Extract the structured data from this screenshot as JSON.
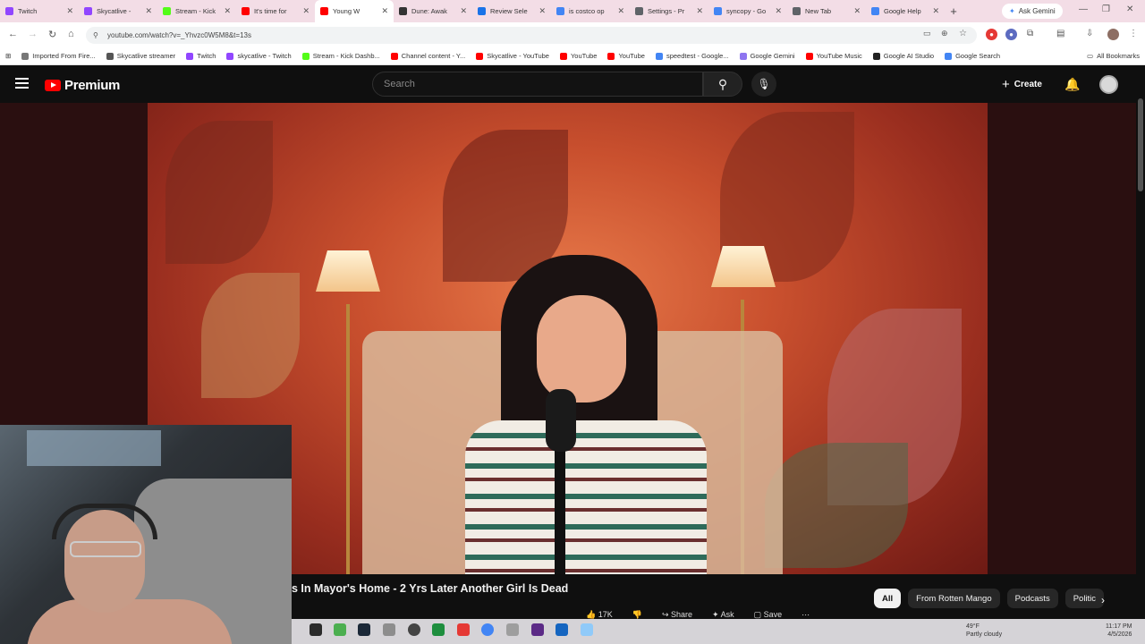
{
  "browser": {
    "tabs": [
      {
        "label": "Twitch",
        "color": "#9146ff"
      },
      {
        "label": "Skycatlive - ",
        "color": "#9146ff"
      },
      {
        "label": "Stream - Kick",
        "color": "#53fc18"
      },
      {
        "label": "It's time for ",
        "color": "#ff0000"
      },
      {
        "label": "Young W",
        "color": "#ff0000",
        "active": true
      },
      {
        "label": "Dune: Awak",
        "color": "#333333"
      },
      {
        "label": "Review Sele",
        "color": "#1a73e8"
      },
      {
        "label": "is costco op",
        "color": "#4285f4"
      },
      {
        "label": "Settings - Pr",
        "color": "#5f6368"
      },
      {
        "label": "syncopy - Go",
        "color": "#4285f4"
      },
      {
        "label": "New Tab",
        "color": "#5f6368"
      },
      {
        "label": "Google Help",
        "color": "#4285f4"
      }
    ],
    "ask_gemini": "Ask Gemini",
    "url": "youtube.com/watch?v=_Yhvzc0W5M8&t=13s",
    "bookmarks": [
      {
        "label": "Imported From Fire...",
        "color": "#777777"
      },
      {
        "label": "Skycatlive streamer",
        "color": "#555555"
      },
      {
        "label": "Twitch",
        "color": "#9146ff"
      },
      {
        "label": "skycatlive - Twitch",
        "color": "#9146ff"
      },
      {
        "label": "Stream - Kick Dashb...",
        "color": "#53fc18"
      },
      {
        "label": "Channel content - Y...",
        "color": "#ff0000"
      },
      {
        "label": "Skycatlive - YouTube",
        "color": "#ff0000"
      },
      {
        "label": "YouTube",
        "color": "#ff0000"
      },
      {
        "label": "YouTube",
        "color": "#ff0000"
      },
      {
        "label": "speedtest - Google...",
        "color": "#4285f4"
      },
      {
        "label": "Google Gemini",
        "color": "#8e75f0"
      },
      {
        "label": "YouTube Music",
        "color": "#ff0000"
      },
      {
        "label": "Google AI Studio",
        "color": "#222222"
      },
      {
        "label": "Google Search",
        "color": "#4285f4"
      }
    ],
    "all_bookmarks": "All Bookmarks"
  },
  "youtube": {
    "brand": "Premium",
    "search_placeholder": "Search",
    "create_label": "Create",
    "video_title": "s In Mayor's Home - 2 Yrs Later Another Girl Is Dead",
    "actions": [
      "17K",
      "Share",
      "Ask",
      "Save"
    ],
    "chips": [
      "All",
      "From Rotten Mango",
      "Podcasts",
      "Politic"
    ]
  },
  "taskbar": {
    "weather_temp": "49°F",
    "weather_desc": "Partly cloudy",
    "time": "11:17 PM",
    "date": "4/5/2026"
  }
}
